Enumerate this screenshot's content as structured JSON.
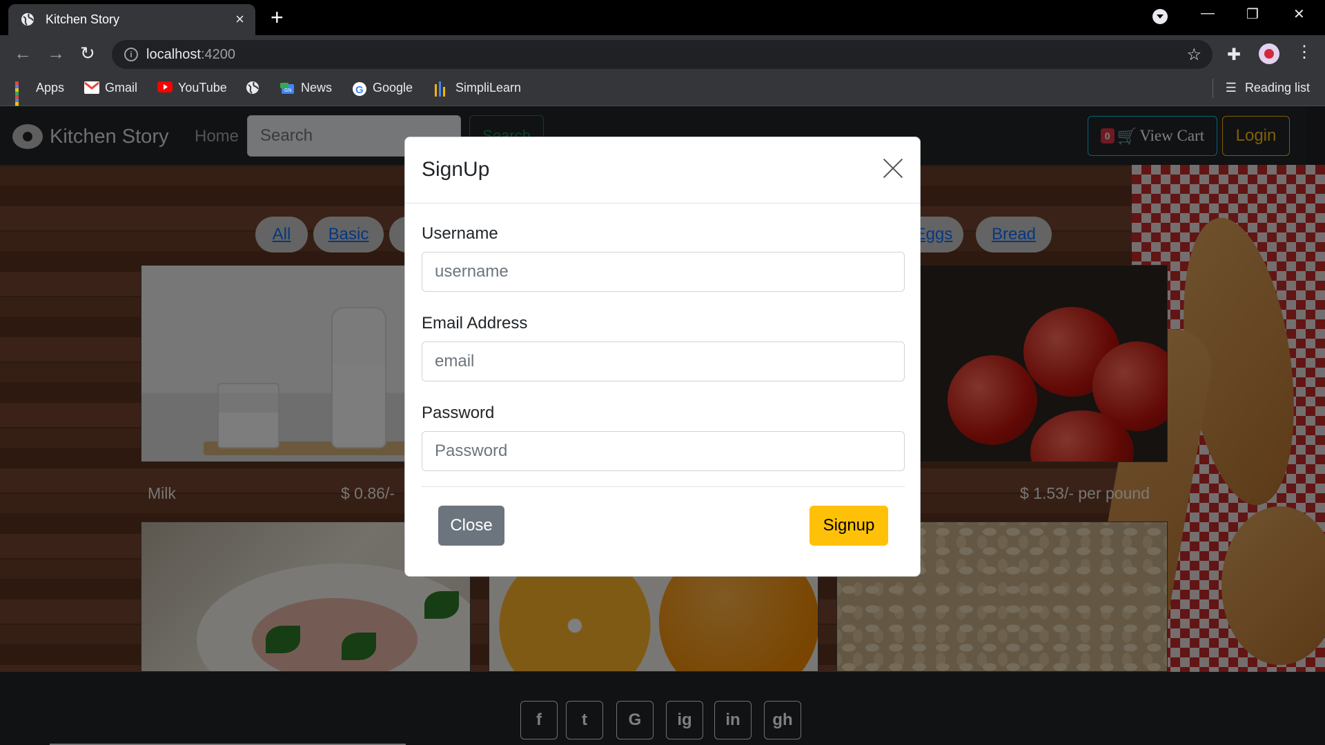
{
  "browser": {
    "tab_title": "Kitchen Story",
    "new_tab": "+",
    "url_host": "localhost",
    "url_port": ":4200",
    "bookmarks": [
      {
        "label": "Apps",
        "icon": "apps-grid-icon"
      },
      {
        "label": "Gmail",
        "icon": "gmail-icon"
      },
      {
        "label": "YouTube",
        "icon": "youtube-icon"
      },
      {
        "label": "",
        "icon": "globe-icon"
      },
      {
        "label": "News",
        "icon": "news-icon"
      },
      {
        "label": "Google",
        "icon": "google-icon"
      },
      {
        "label": "SimpliLearn",
        "icon": "simplilearn-icon"
      }
    ],
    "reading_list": "Reading list"
  },
  "site": {
    "brand": "Kitchen Story",
    "home": "Home",
    "search_placeholder": "Search",
    "search_button": "Search",
    "cart_count": "0",
    "cart_label": "View Cart",
    "login": "Login"
  },
  "categories": [
    "All",
    "Basic",
    "Eggs",
    "Bread"
  ],
  "products": [
    {
      "name": "Milk",
      "price": "$ 0.86/-"
    },
    {
      "name": "",
      "price": "$ 1.53/- per pound"
    }
  ],
  "footer": {
    "social": [
      "f",
      "t",
      "G",
      "ig",
      "in",
      "gh"
    ]
  },
  "modal": {
    "title": "SignUp",
    "username_label": "Username",
    "username_placeholder": "username",
    "email_label": "Email Address",
    "email_placeholder": "email",
    "password_label": "Password",
    "password_placeholder": "Password",
    "close_button": "Close",
    "signup_button": "Signup"
  },
  "colors": {
    "accent_warning": "#ffc107",
    "secondary": "#6c757d",
    "info": "#0dcaf0",
    "danger": "#dc3545",
    "link": "#0d6efd"
  }
}
